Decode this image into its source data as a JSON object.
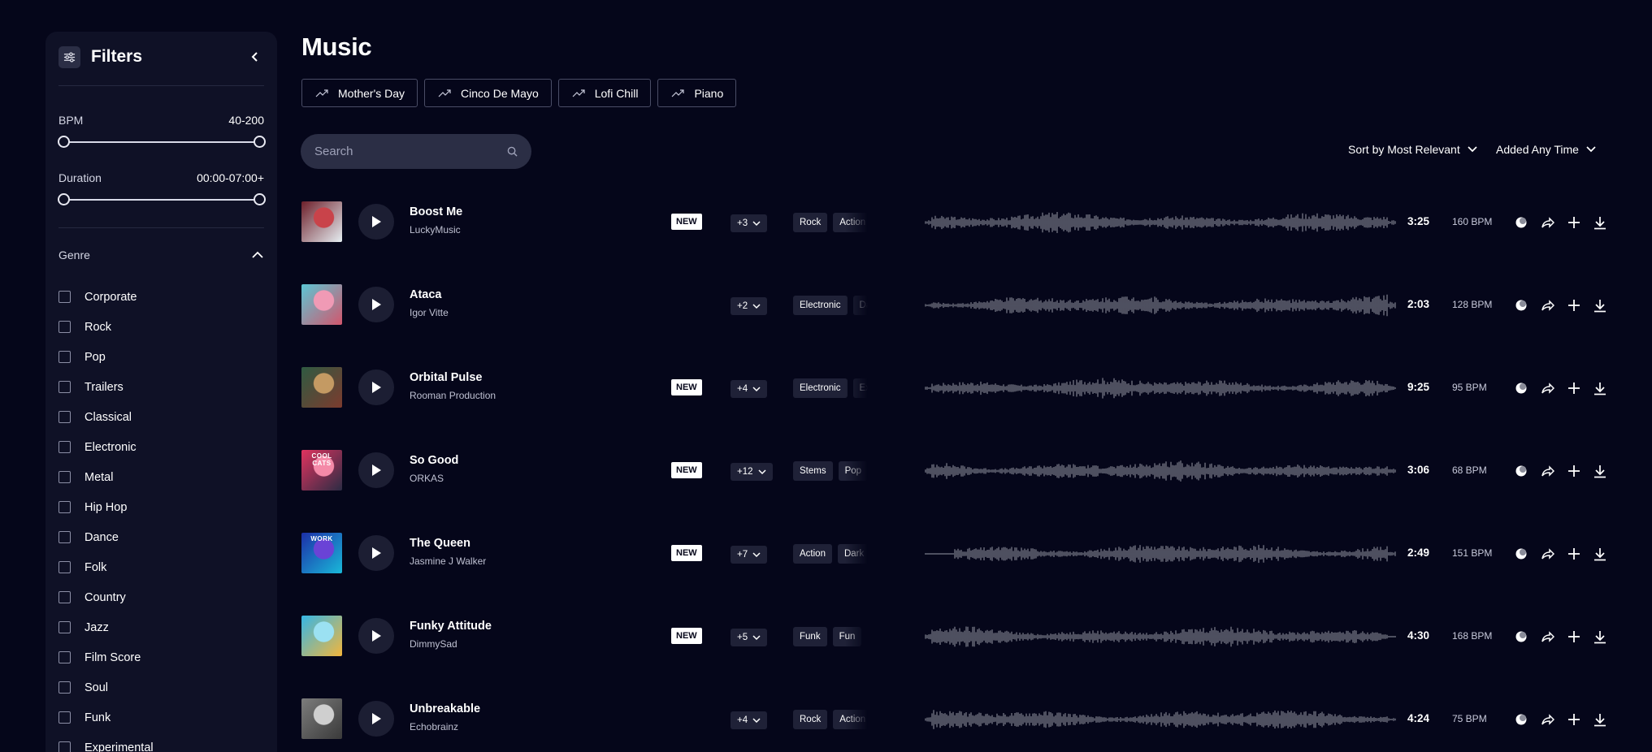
{
  "sidebar": {
    "title": "Filters",
    "bpm": {
      "label": "BPM",
      "value": "40-200",
      "min": 40,
      "max": 200,
      "low": 40,
      "high": 200
    },
    "duration": {
      "label": "Duration",
      "value": "00:00-07:00+"
    },
    "genre": {
      "label": "Genre",
      "items": [
        "Corporate",
        "Rock",
        "Pop",
        "Trailers",
        "Classical",
        "Electronic",
        "Metal",
        "Hip Hop",
        "Dance",
        "Folk",
        "Country",
        "Jazz",
        "Film Score",
        "Soul",
        "Funk",
        "Experimental"
      ]
    }
  },
  "main": {
    "title": "Music",
    "trending": [
      "Mother's Day",
      "Cinco De Mayo",
      "Lofi Chill",
      "Piano"
    ],
    "search_placeholder": "Search",
    "sort_label": "Sort by Most Relevant",
    "time_label": "Added Any Time",
    "new_badge": "NEW"
  },
  "tracks": [
    {
      "title": "Boost Me",
      "artist": "LuckyMusic",
      "is_new": true,
      "more": "+3",
      "tags": [
        "Rock",
        "Action"
      ],
      "duration": "3:25",
      "bpm": "160 BPM",
      "cover": [
        "#6d1f2a",
        "#c9434a",
        "#e6eef2"
      ]
    },
    {
      "title": "Ataca",
      "artist": "Igor Vitte",
      "is_new": false,
      "more": "+2",
      "tags": [
        "Electronic",
        "Dance"
      ],
      "duration": "2:03",
      "bpm": "128 BPM",
      "cover": [
        "#5cc6d4",
        "#f09ab5",
        "#d2566d"
      ]
    },
    {
      "title": "Orbital Pulse",
      "artist": "Rooman Production",
      "is_new": true,
      "more": "+4",
      "tags": [
        "Electronic",
        "Experimental"
      ],
      "duration": "9:25",
      "bpm": "95 BPM",
      "cover": [
        "#2f5a42",
        "#c49a63",
        "#7c3b2e"
      ]
    },
    {
      "title": "So Good",
      "artist": "ORKAS",
      "is_new": true,
      "more": "+12",
      "tags": [
        "Stems",
        "Pop"
      ],
      "duration": "3:06",
      "bpm": "68 BPM",
      "cover": [
        "#e0335f",
        "#f48aa8",
        "#2c2c44"
      ],
      "cover_text": "COOL CATS"
    },
    {
      "title": "The Queen",
      "artist": "Jasmine J Walker",
      "is_new": true,
      "more": "+7",
      "tags": [
        "Action",
        "Dark"
      ],
      "duration": "2:49",
      "bpm": "151 BPM",
      "cover": [
        "#1c2fa8",
        "#6a43d6",
        "#1ab9d9"
      ],
      "cover_text": "WORK"
    },
    {
      "title": "Funky Attitude",
      "artist": "DimmySad",
      "is_new": true,
      "more": "+5",
      "tags": [
        "Funk",
        "Fun"
      ],
      "duration": "4:30",
      "bpm": "168 BPM",
      "cover": [
        "#36b7e6",
        "#9be1f2",
        "#f2b53c"
      ]
    },
    {
      "title": "Unbreakable",
      "artist": "Echobrainz",
      "is_new": false,
      "more": "+4",
      "tags": [
        "Rock",
        "Action"
      ],
      "duration": "4:24",
      "bpm": "75 BPM",
      "cover": [
        "#7c7c7c",
        "#cfcfcf",
        "#3a3a3a"
      ]
    }
  ]
}
